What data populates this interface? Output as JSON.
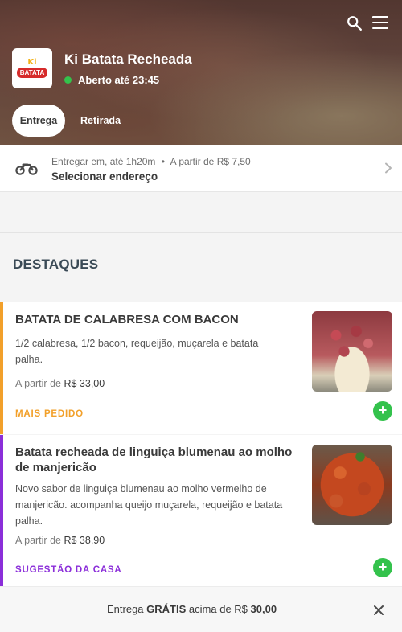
{
  "header": {
    "store_name": "Ki Batata Recheada",
    "status": "Aberto até 23:45",
    "status_color": "#34c24c",
    "logo": {
      "top_text": "Ki",
      "badge_text": "BATATA",
      "badge_color": "#d62b2b"
    },
    "icons": [
      "search-icon",
      "menu-icon"
    ],
    "tabs": [
      {
        "label": "Entrega",
        "selected": true
      },
      {
        "label": "Retirada",
        "selected": false
      }
    ]
  },
  "delivery": {
    "icon": "motorcycle-icon",
    "prefix": "Entregar em,",
    "time": "até 1h20m",
    "separator": "•",
    "min_price": "A partir de R$ 7,50",
    "address_label": "Selecionar endereço"
  },
  "section": {
    "title": "DESTAQUES"
  },
  "products": [
    {
      "title": "BATATA DE CALABRESA COM BACON",
      "description": "1/2 calabresa, 1/2 bacon, requeijão, muçarela e batata palha.",
      "price_prefix": "A partir de",
      "price": "R$ 33,00",
      "tag": "MAIS PEDIDO",
      "tag_color": "#f2a02a",
      "add_label": "+"
    },
    {
      "title": "Batata recheada de linguiça blumenau ao molho de manjericão",
      "description": "Novo sabor de linguiça blumenau ao molho vermelho de manjericão. acompanha queijo muçarela, requeijão e batata palha.",
      "price_prefix": "A partir de",
      "price": "R$ 38,90",
      "tag": "SUGESTÃO DA CASA",
      "tag_color": "#8b2ed9",
      "add_label": "+"
    }
  ],
  "banner": {
    "part1": "Entrega",
    "part2": "GRÁTIS",
    "part3": "acima de R$",
    "part4": "30,00"
  },
  "colors": {
    "accent_green": "#34c24c",
    "accent_orange": "#f2a02a",
    "accent_purple": "#8b2ed9"
  }
}
